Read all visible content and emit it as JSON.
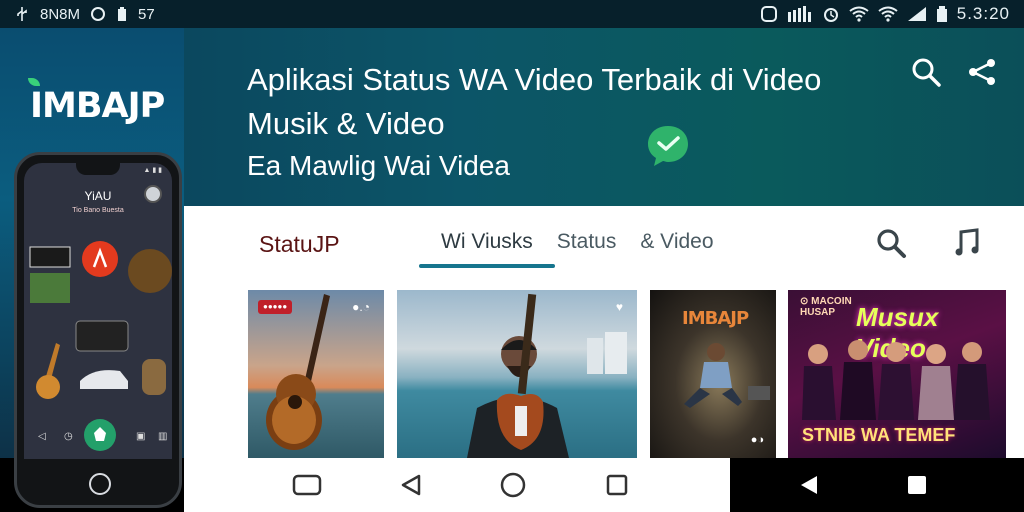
{
  "status_bar": {
    "left_text": "8N8M",
    "battery_text": "57",
    "time": "5.3:20"
  },
  "brand": {
    "logo": "IMBAJP"
  },
  "hero": {
    "title": "Aplikasi Status WA Video Terbaik di Video Musik & Video",
    "subtitle": "Ea Mawlig Wai Videa"
  },
  "app": {
    "title": "StatuJP",
    "tabs": [
      {
        "label": "Wi Viusks",
        "active": true
      },
      {
        "label": "Status",
        "active": false
      },
      {
        "label": "& Video",
        "active": false
      }
    ]
  },
  "thumbnails": [
    {
      "badge": "",
      "subject": "acoustic guitar at sunset by the sea"
    },
    {
      "subject": "man holding electric guitar by the sea"
    },
    {
      "label": "IMBAJP",
      "subject": "man sitting on stage under spotlight"
    },
    {
      "label": "Musux Video",
      "footer": "STNIB WA TEMEF",
      "subject": "group of performers with neon lights"
    }
  ],
  "phone": {
    "title": "YiAU",
    "sub": "Tio Bano Buesta"
  },
  "colors": {
    "accent": "#16758e",
    "hero_bg": "#0c5568",
    "brand_red": "#5a1414"
  },
  "icons": {
    "hero_search": "search-icon",
    "hero_share": "share-icon",
    "content_search": "search-icon",
    "content_music": "music-note-icon"
  }
}
